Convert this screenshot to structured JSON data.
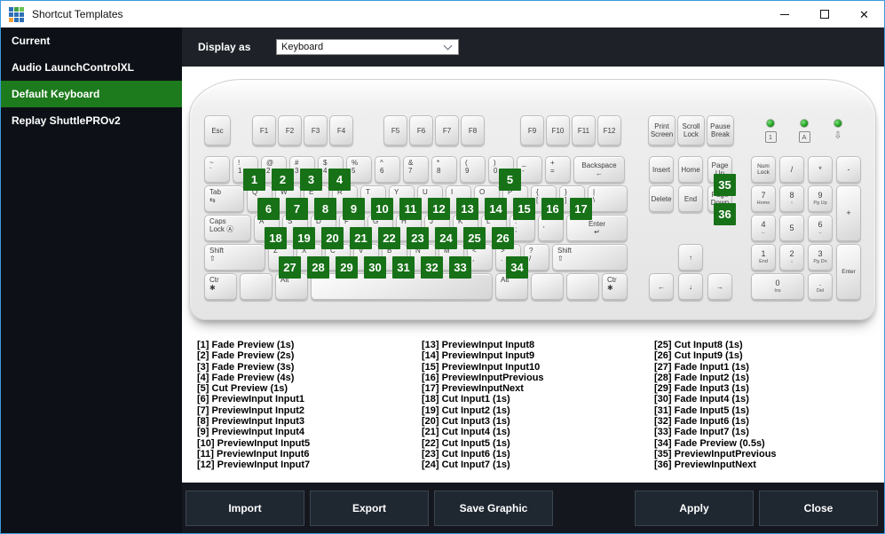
{
  "window": {
    "title": "Shortcut Templates",
    "app_icon_colors": [
      "#2e6fb7",
      "#43a047",
      "#69c24f",
      "#2e6fb7",
      "#2e6fb7",
      "#2e6fb7",
      "#f2a33c",
      "#2e6fb7",
      "#2e6fb7"
    ]
  },
  "icons": {
    "close": "✕"
  },
  "colors": {
    "accent_green": "#1d7a1d",
    "badge_green": "#177117",
    "window_border": "#3a9add"
  },
  "sidebar": {
    "items": [
      {
        "label": "Current",
        "selected": false
      },
      {
        "label": "Audio LaunchControlXL",
        "selected": false
      },
      {
        "label": "Default Keyboard",
        "selected": true
      },
      {
        "label": "Replay ShuttlePROv2",
        "selected": false
      }
    ]
  },
  "header": {
    "display_as": {
      "label": "Display as",
      "value": "Keyboard"
    }
  },
  "keyboard": {
    "esc": "Esc",
    "fn_groups": [
      [
        "F1",
        "F2",
        "F3",
        "F4"
      ],
      [
        "F5",
        "F6",
        "F7",
        "F8"
      ],
      [
        "F9",
        "F10",
        "F11",
        "F12"
      ]
    ],
    "sys_keys": [
      [
        "Print",
        "Screen"
      ],
      [
        "Scroll",
        "Lock"
      ],
      [
        "Pause",
        "Break"
      ]
    ],
    "leds": [
      {
        "t": "1",
        "box": true
      },
      {
        "t": "A",
        "box": true
      },
      {
        "t": "⇩",
        "box": false
      }
    ],
    "main_rows": [
      [
        {
          "l": [
            "~",
            "`"
          ]
        },
        {
          "l": [
            "!",
            "1"
          ],
          "badge": 1
        },
        {
          "l": [
            "@",
            "2"
          ],
          "badge": 2
        },
        {
          "l": [
            "#",
            "3"
          ],
          "badge": 3
        },
        {
          "l": [
            "$",
            "4"
          ],
          "badge": 4
        },
        {
          "l": [
            "%",
            "5"
          ]
        },
        {
          "l": [
            "^",
            "6"
          ]
        },
        {
          "l": [
            "&",
            "7"
          ]
        },
        {
          "l": [
            "*",
            "8"
          ]
        },
        {
          "l": [
            "(",
            "9"
          ]
        },
        {
          "l": [
            ")",
            "0"
          ],
          "badge": 5
        },
        {
          "l": [
            "_",
            "-"
          ]
        },
        {
          "l": [
            "+",
            "="
          ]
        },
        {
          "l": [
            "Backspace",
            "←"
          ],
          "w": "bksp",
          "center": true
        }
      ],
      [
        {
          "l": [
            "Tab",
            "⇆"
          ],
          "w": "1.5"
        },
        {
          "l": [
            "Q"
          ],
          "badge": 6
        },
        {
          "l": [
            "W"
          ],
          "badge": 7
        },
        {
          "l": [
            "E"
          ],
          "badge": 8
        },
        {
          "l": [
            "R"
          ],
          "badge": 9
        },
        {
          "l": [
            "T"
          ],
          "badge": 10
        },
        {
          "l": [
            "Y"
          ],
          "badge": 11
        },
        {
          "l": [
            "U"
          ],
          "badge": 12
        },
        {
          "l": [
            "I"
          ],
          "badge": 13
        },
        {
          "l": [
            "O"
          ],
          "badge": 14
        },
        {
          "l": [
            "P"
          ],
          "badge": 15
        },
        {
          "l": [
            "{",
            "["
          ],
          "badge": 16
        },
        {
          "l": [
            "}",
            "]"
          ],
          "badge": 17
        },
        {
          "l": [
            "|",
            "\\"
          ],
          "w": "1.5"
        }
      ],
      [
        {
          "l": [
            "Caps",
            "Lock Ⓐ"
          ],
          "w": "1.75"
        },
        {
          "l": [
            "A"
          ],
          "badge": 18
        },
        {
          "l": [
            "S"
          ],
          "badge": 19
        },
        {
          "l": [
            "D"
          ],
          "badge": 20
        },
        {
          "l": [
            "F"
          ],
          "badge": 21
        },
        {
          "l": [
            "G"
          ],
          "badge": 22
        },
        {
          "l": [
            "H"
          ],
          "badge": 23
        },
        {
          "l": [
            "J"
          ],
          "badge": 24
        },
        {
          "l": [
            "K"
          ],
          "badge": 25
        },
        {
          "l": [
            "L"
          ],
          "badge": 26
        },
        {
          "l": [
            ":",
            ";"
          ]
        },
        {
          "l": [
            "\"",
            "'"
          ]
        },
        {
          "l": [
            "Enter",
            "↵"
          ],
          "w": "2.25",
          "center": true
        }
      ],
      [
        {
          "l": [
            "Shift",
            "⇧"
          ],
          "w": "2.25"
        },
        {
          "l": [
            "Z"
          ],
          "badge": 27
        },
        {
          "l": [
            "X"
          ],
          "badge": 28
        },
        {
          "l": [
            "C"
          ],
          "badge": 29
        },
        {
          "l": [
            "V"
          ],
          "badge": 30
        },
        {
          "l": [
            "B"
          ],
          "badge": 31
        },
        {
          "l": [
            "N"
          ],
          "badge": 32
        },
        {
          "l": [
            "M"
          ],
          "badge": 33
        },
        {
          "l": [
            "<",
            ","
          ]
        },
        {
          "l": [
            ">",
            "."
          ],
          "badge": 34
        },
        {
          "l": [
            "?",
            "/"
          ]
        },
        {
          "l": [
            "Shift",
            "⇧"
          ],
          "w": "2.75"
        }
      ],
      [
        {
          "l": [
            "Ctr",
            "✱"
          ],
          "w": "1.25"
        },
        {
          "l": [],
          "w": "1.25"
        },
        {
          "l": [
            "Alt"
          ],
          "w": "1.25"
        },
        {
          "l": [],
          "w": "space"
        },
        {
          "l": [
            "Alt"
          ],
          "w": "1.25"
        },
        {
          "l": [],
          "w": "1.25"
        },
        {
          "l": [],
          "w": "1.25"
        },
        {
          "l": [
            "Ctr",
            "✱"
          ]
        }
      ]
    ],
    "nav_rows": [
      [
        {
          "l": [
            "Insert"
          ]
        },
        {
          "l": [
            "Home"
          ]
        },
        {
          "l": [
            "Page",
            "Up"
          ],
          "badge": 35
        }
      ],
      [
        {
          "l": [
            "Delete"
          ]
        },
        {
          "l": [
            "End"
          ]
        },
        {
          "l": [
            "Page",
            "Down"
          ],
          "badge": 36
        }
      ]
    ],
    "arrows": {
      "up": "↑",
      "left": "←",
      "down": "↓",
      "right": "→"
    },
    "numpad": [
      {
        "l": [
          "Num",
          "Lock"
        ],
        "tiny": true
      },
      {
        "l": [
          "/"
        ]
      },
      {
        "l": [
          "*"
        ]
      },
      {
        "l": [
          "-"
        ]
      },
      {
        "l": [
          "7"
        ],
        "s": "Home"
      },
      {
        "l": [
          "8"
        ],
        "s": "↑"
      },
      {
        "l": [
          "9"
        ],
        "s": "Pg Up"
      },
      {
        "l": [
          "+"
        ],
        "rs": 2
      },
      {
        "l": [
          "4"
        ],
        "s": "←"
      },
      {
        "l": [
          "5"
        ]
      },
      {
        "l": [
          "6"
        ],
        "s": "→"
      },
      {
        "l": [
          "1"
        ],
        "s": "End"
      },
      {
        "l": [
          "2"
        ],
        "s": "↓"
      },
      {
        "l": [
          "3"
        ],
        "s": "Pg Dn"
      },
      {
        "l": [
          "Enter"
        ],
        "rs": 2,
        "tiny": true
      },
      {
        "l": [
          "0"
        ],
        "s": "Ins",
        "cs": 2
      },
      {
        "l": [
          "."
        ],
        "s": "Del"
      }
    ]
  },
  "legend": {
    "columns": [
      [
        "[1] Fade Preview (1s)",
        "[2] Fade Preview (2s)",
        "[3] Fade Preview (3s)",
        "[4] Fade Preview (4s)",
        "[5] Cut Preview (1s)",
        "[6] PreviewInput Input1",
        "[7] PreviewInput Input2",
        "[8] PreviewInput Input3",
        "[9] PreviewInput Input4",
        "[10] PreviewInput Input5",
        "[11] PreviewInput Input6",
        "[12] PreviewInput Input7"
      ],
      [
        "[13] PreviewInput Input8",
        "[14] PreviewInput Input9",
        "[15] PreviewInput Input10",
        "[16] PreviewInputPrevious",
        "[17] PreviewInputNext",
        "[18] Cut Input1 (1s)",
        "[19] Cut Input2 (1s)",
        "[20] Cut Input3 (1s)",
        "[21] Cut Input4 (1s)",
        "[22] Cut Input5 (1s)",
        "[23] Cut Input6 (1s)",
        "[24] Cut Input7 (1s)"
      ],
      [
        "[25] Cut Input8 (1s)",
        "[26] Cut Input9 (1s)",
        "[27] Fade Input1 (1s)",
        "[28] Fade Input2 (1s)",
        "[29] Fade Input3 (1s)",
        "[30] Fade Input4 (1s)",
        "[31] Fade Input5 (1s)",
        "[32] Fade Input6 (1s)",
        "[33] Fade Input7 (1s)",
        "[34] Fade Preview (0.5s)",
        "[35] PreviewInputPrevious",
        "[36] PreviewInputNext"
      ]
    ]
  },
  "footer": {
    "buttons": [
      "Import",
      "Export",
      "Save Graphic",
      "Apply",
      "Close"
    ]
  }
}
